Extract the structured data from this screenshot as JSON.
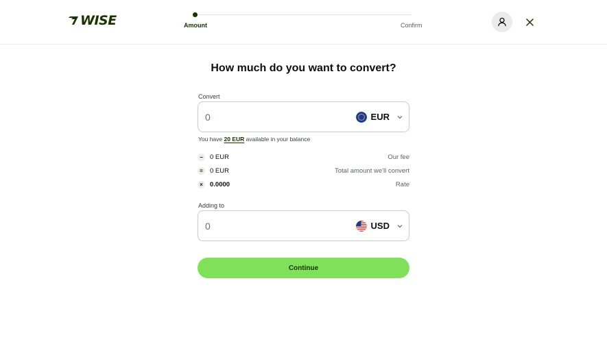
{
  "header": {
    "logo_text": "WISE",
    "steps": [
      {
        "label": "Amount",
        "active": true
      },
      {
        "label": "Confirm",
        "active": false
      }
    ],
    "profile_icon": "person-icon",
    "close_icon": "close-icon"
  },
  "main": {
    "title": "How much do you want to convert?",
    "convert": {
      "label": "Convert",
      "value": "0",
      "currency": "EUR",
      "flag": "eu-flag-icon"
    },
    "balance": {
      "prefix": "You have",
      "amount": "20 EUR",
      "suffix": "available in your balance"
    },
    "fees": [
      {
        "symbol": "−",
        "value": "0 EUR",
        "label": "Our fee"
      },
      {
        "symbol": "=",
        "value": "0 EUR",
        "label": "Total amount we'll convert"
      },
      {
        "symbol": "×",
        "value": "0.0000",
        "label": "Rate"
      }
    ],
    "adding_to": {
      "label": "Adding to",
      "value": "0",
      "currency": "USD",
      "flag": "us-flag-icon"
    },
    "continue_label": "Continue"
  },
  "colors": {
    "brand_dark": "#163300",
    "brand_green": "#80e05a"
  }
}
